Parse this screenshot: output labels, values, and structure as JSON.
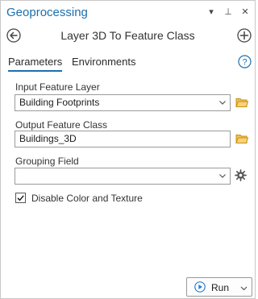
{
  "pane": {
    "title": "Geoprocessing",
    "controls": {
      "menu_glyph": "▾",
      "pin_glyph": "⊥",
      "close_glyph": "✕"
    }
  },
  "toolbar": {
    "tool_title": "Layer 3D To Feature Class",
    "back_icon": "back-arrow-icon",
    "add_icon": "add-icon"
  },
  "tabs": [
    {
      "label": "Parameters",
      "active": true
    },
    {
      "label": "Environments",
      "active": false
    }
  ],
  "help_glyph": "?",
  "params": {
    "input_layer": {
      "label": "Input Feature Layer",
      "value": "Building Footprints"
    },
    "output_class": {
      "label": "Output Feature Class",
      "value": "Buildings_3D"
    },
    "grouping": {
      "label": "Grouping Field",
      "value": ""
    },
    "disable_color": {
      "label": "Disable Color and Texture",
      "checked": true
    }
  },
  "run": {
    "label": "Run"
  },
  "colors": {
    "accent": "#1a6fb0",
    "folder": "#d9a520",
    "play": "#2a7fd0"
  }
}
